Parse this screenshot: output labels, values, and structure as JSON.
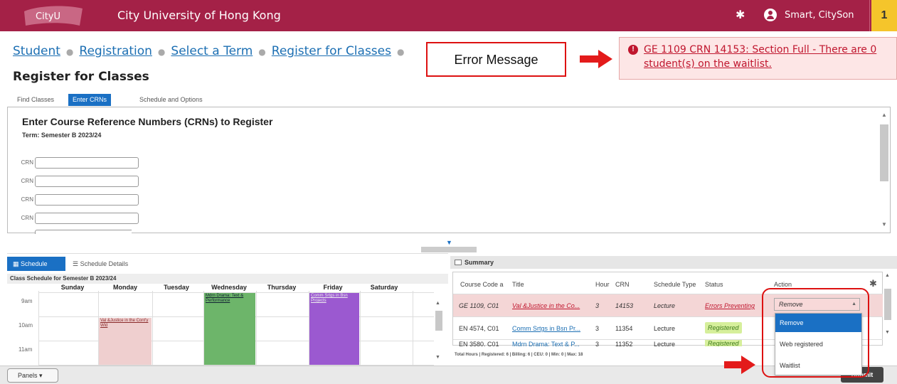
{
  "header": {
    "logo_text": "CityU",
    "university": "City University of Hong Kong",
    "user_name": "Smart, CitySon",
    "notification_count": "1"
  },
  "breadcrumb": [
    "Student",
    "Registration",
    "Select a Term",
    "Register for Classes"
  ],
  "page_title": "Register for Classes",
  "callout_label": "Error Message",
  "error": {
    "text": "GE 1109 CRN 14153: Section Full - There are 0 student(s) on the waitlist."
  },
  "tabs": [
    "Find Classes",
    "Enter CRNs",
    "Schedule and Options"
  ],
  "crn": {
    "title": "Enter Course Reference Numbers (CRNs) to Register",
    "term": "Term: Semester B 2023/24",
    "field_label": "CRN",
    "fields": [
      "",
      "",
      "",
      "",
      ""
    ]
  },
  "schedule": {
    "tab_active": "Schedule",
    "tab_other": "Schedule Details",
    "caption": "Class Schedule for Semester B 2023/24",
    "days": [
      "Sunday",
      "Monday",
      "Tuesday",
      "Wednesday",
      "Thursday",
      "Friday",
      "Saturday"
    ],
    "times": [
      "9am",
      "10am",
      "11am"
    ],
    "blocks": {
      "monday": "Val &Justice in the Cont'y Wld",
      "wednesday": "Mdrn Drama: Text & Performance",
      "friday": "Comm Srtgs in Bsn Projects"
    },
    "colors": {
      "monday": "#efcfcf",
      "wednesday": "#6db56a",
      "friday": "#9b59d0"
    }
  },
  "summary": {
    "title": "Summary",
    "columns": [
      "Course Code a",
      "Title",
      "Hours",
      "CRN",
      "Schedule Type",
      "Status",
      "Action"
    ],
    "rows": [
      {
        "code": "GE 1109, C01",
        "title": "Val &Justice in the Co...",
        "hours": "3",
        "crn": "14153",
        "type": "Lecture",
        "status": "Errors Preventing",
        "action": "Remove"
      },
      {
        "code": "EN 4574, C01",
        "title": "Comm Srtgs in Bsn Pr...",
        "hours": "3",
        "crn": "11354",
        "type": "Lecture",
        "status": "Registered"
      },
      {
        "code": "EN 3580, C01",
        "title": "Mdrn Drama: Text & P...",
        "hours": "3",
        "crn": "11352",
        "type": "Lecture",
        "status": "Registered"
      }
    ],
    "footer": "Total Hours | Registered: 6 | Billing: 6 | CEU: 0 | Min: 0 | Max: 18"
  },
  "action_options": [
    "Remove",
    "Web registered",
    "Waitlist"
  ],
  "bottom": {
    "panels": "Panels",
    "submit": "Submit"
  }
}
